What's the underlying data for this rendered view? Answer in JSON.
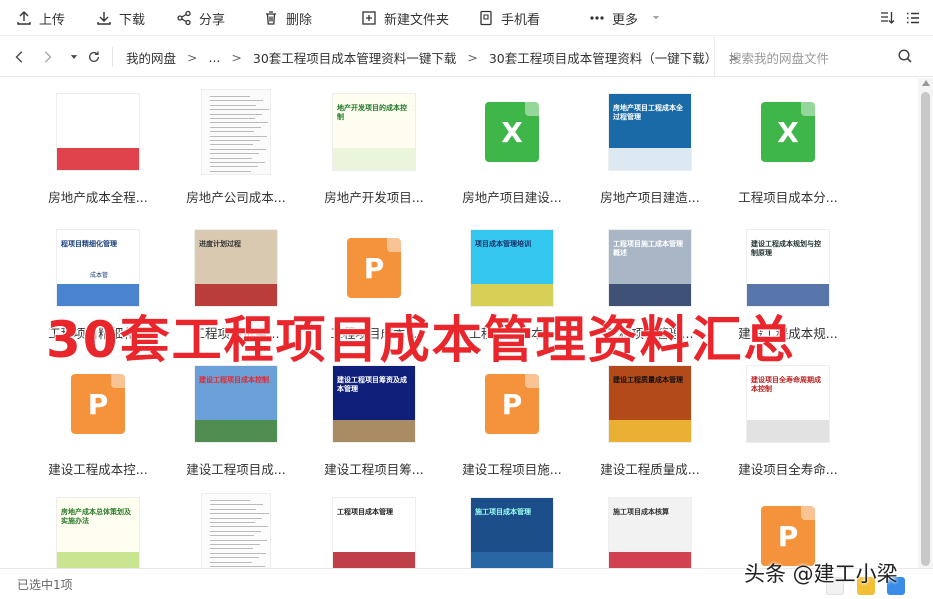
{
  "toolbar": {
    "upload": "上传",
    "download": "下载",
    "share": "分享",
    "delete": "删除",
    "new_folder": "新建文件夹",
    "phone_view": "手机看",
    "more": "更多"
  },
  "address": {
    "crumbs": [
      "我的网盘",
      "...",
      "30套工程项目成本管理资料一键下载",
      "30套工程项目成本管理资料（一键下载）"
    ],
    "search_placeholder": "搜索我的网盘文件"
  },
  "files": [
    {
      "name": "房地产成本全程...",
      "kind": "ppt",
      "thumb_text": "房地产成本全程精细化管控体系实战解析",
      "thumb_sub": "2017年6月28日"
    },
    {
      "name": "房地产公司成本...",
      "kind": "doc",
      "thumb_text": ""
    },
    {
      "name": "房地产开发项目...",
      "kind": "ppt",
      "thumb_text": "地产开发项目的成本控制"
    },
    {
      "name": "房地产项目建设...",
      "kind": "xls",
      "thumb_text": ""
    },
    {
      "name": "房地产项目建造...",
      "kind": "ppt",
      "thumb_text": "房地产项目工程成本全过程管理"
    },
    {
      "name": "工程项目成本分...",
      "kind": "xls",
      "thumb_text": ""
    },
    {
      "name": "工程项目精细化...",
      "kind": "ppt",
      "thumb_text": "程项目精细化管理",
      "thumb_sub": "成本管"
    },
    {
      "name": "工程项目进度...",
      "kind": "ppt",
      "thumb_text": "进度计划过程"
    },
    {
      "name": "工程项目成本...",
      "kind": "ppt-icon",
      "thumb_text": ""
    },
    {
      "name": "工程项目成本...",
      "kind": "ppt",
      "thumb_text": "项目成本管理培训"
    },
    {
      "name": "工程项目管理...",
      "kind": "ppt",
      "thumb_text": "工程项目施工成本管理概述"
    },
    {
      "name": "建设工程成本规...",
      "kind": "ppt",
      "thumb_text": "建设工程成本规划与控制原理"
    },
    {
      "name": "建设工程成本控...",
      "kind": "ppt-icon",
      "thumb_text": ""
    },
    {
      "name": "建设工程项目成...",
      "kind": "ppt",
      "thumb_text": "建设工程项目成本控制"
    },
    {
      "name": "建设工程项目筹...",
      "kind": "ppt",
      "thumb_text": "建设工程项目筹资及成本管理"
    },
    {
      "name": "建设工程项目施...",
      "kind": "ppt-icon",
      "thumb_text": ""
    },
    {
      "name": "建设工程质量成...",
      "kind": "ppt",
      "thumb_text": "建设工程质量成本管理"
    },
    {
      "name": "建设项目全寿命...",
      "kind": "ppt",
      "thumb_text": "建设项目全寿命周期成本控制"
    },
    {
      "name": "",
      "kind": "ppt",
      "thumb_text": "房地产成本总体策划及实施办法"
    },
    {
      "name": "",
      "kind": "doc",
      "thumb_text": ""
    },
    {
      "name": "",
      "kind": "ppt",
      "thumb_text": "工程项目成本管理"
    },
    {
      "name": "",
      "kind": "ppt",
      "thumb_text": "施工项目成本管理"
    },
    {
      "name": "",
      "kind": "ppt",
      "thumb_text": "施工项目成本核算"
    },
    {
      "name": "",
      "kind": "ppt-icon",
      "thumb_text": ""
    }
  ],
  "status": "已选中1项",
  "overlay_title": "30套工程项目成本管理资料汇总",
  "watermark": "头条 @建工小梁",
  "colors": {
    "ppt": "#f5933d",
    "xls": "#3fb64a",
    "accent_red": "#e8262c"
  }
}
